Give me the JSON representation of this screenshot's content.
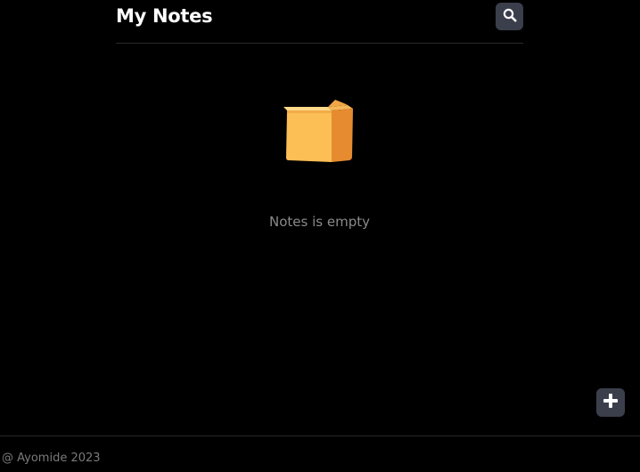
{
  "header": {
    "title": "My Notes",
    "search_icon": "search-icon"
  },
  "empty_state": {
    "icon": "box-icon",
    "message": "Notes is empty"
  },
  "fab": {
    "icon": "plus-icon"
  },
  "footer": {
    "text": "@ Ayomide 2023"
  },
  "colors": {
    "background": "#000000",
    "button_bg": "#3b3f4c",
    "divider": "#2a2a2a",
    "muted_text": "#8a8a8a",
    "box_orange": "#f2a13b"
  }
}
